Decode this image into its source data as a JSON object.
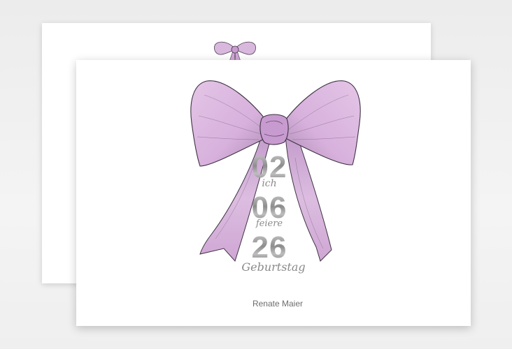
{
  "card": {
    "day": "02",
    "word1": "ich",
    "month": "06",
    "word2": "feiere",
    "year": "26",
    "word3": "Geburtstag",
    "name": "Renate Maier"
  },
  "colors": {
    "bow": "#d9b8dd",
    "bow_shadow": "#b58cbd",
    "bow_outline": "#4a3a4e",
    "numbers": "#9a9a9a"
  },
  "icons": {
    "decoration": "pink-bow-icon"
  }
}
